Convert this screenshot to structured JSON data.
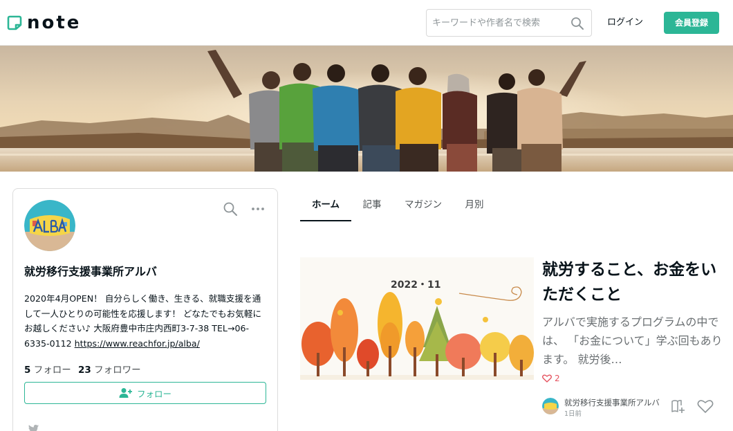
{
  "header": {
    "logo_text": "note",
    "search_placeholder": "キーワードや作者名で検索",
    "login_label": "ログイン",
    "register_label": "会員登録"
  },
  "profile": {
    "name": "就労移行支援事業所アルバ",
    "avatar_text": "ALBA",
    "bio_text": "2020年4月OPEN！ 自分らしく働き、生きる、就職支援を通して一人ひとりの可能性を応援します！ どなたでもお気軽にお越しください♪ 大阪府豊中市庄内西町3-7-38 TEL→06-6335-0112 ",
    "bio_link": "https://www.reachfor.jp/alba/",
    "following_count": "5",
    "following_label": "フォロー",
    "follower_count": "23",
    "follower_label": "フォロワー",
    "follow_button_label": "フォロー"
  },
  "tabs": [
    {
      "label": "ホーム",
      "active": true
    },
    {
      "label": "記事",
      "active": false
    },
    {
      "label": "マガジン",
      "active": false
    },
    {
      "label": "月別",
      "active": false
    }
  ],
  "article": {
    "thumbnail_text": "2022・11",
    "title": "就労すること、お金をいただくこと",
    "excerpt": "アルバで実施するプログラムの中では、 「お金について」学ぶ回もあります。 就労後…",
    "like_count": "2",
    "author_name": "就労移行支援事業所アルバ",
    "posted_time": "1日前"
  },
  "colors": {
    "brand_green": "#2cb696",
    "like_red": "#e5505d"
  }
}
